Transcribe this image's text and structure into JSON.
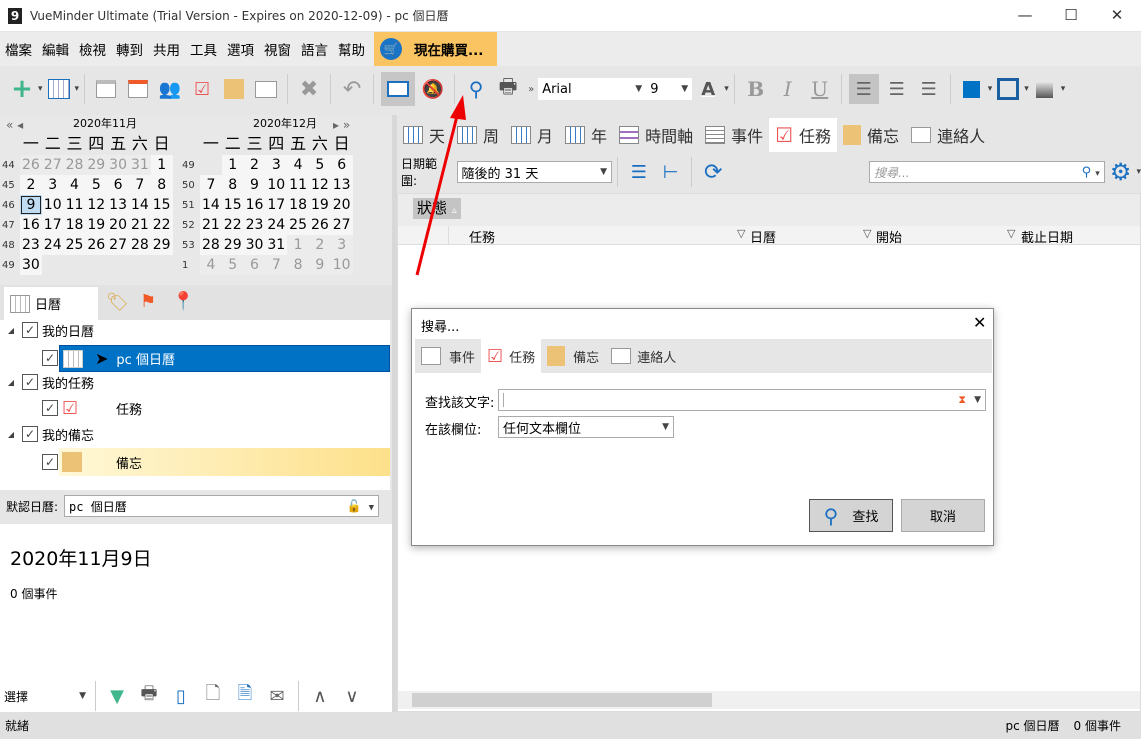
{
  "window": {
    "title": "VueMinder Ultimate (Trial Version - Expires on 2020-12-09) - pc 個日曆",
    "app_icon": "9",
    "minimize": "—",
    "maximize": "☐",
    "close": "✕"
  },
  "menu": [
    "檔案",
    "編輯",
    "檢視",
    "轉到",
    "共用",
    "工具",
    "選項",
    "視窗",
    "語言",
    "幫助"
  ],
  "buy_label": "現在購買...",
  "toolbar": {
    "font": "Arial",
    "size": "9",
    "bold": "B",
    "italic": "I",
    "underline": "U",
    "font_color": "A",
    "fill_color": "#0072c6",
    "border_color": "#1a5fa0"
  },
  "calendar": {
    "prev": "«  ◂",
    "next": "▸  »",
    "dow": [
      "一",
      "二",
      "三",
      "四",
      "五",
      "六",
      "日"
    ],
    "months": [
      {
        "title": "2020年11月",
        "selected": "9",
        "weeks": [
          [
            "44",
            "26",
            "27",
            "28",
            "29",
            "30",
            "31",
            "1"
          ],
          [
            "45",
            "2",
            "3",
            "4",
            "5",
            "6",
            "7",
            "8"
          ],
          [
            "46",
            "9",
            "10",
            "11",
            "12",
            "13",
            "14",
            "15"
          ],
          [
            "47",
            "16",
            "17",
            "18",
            "19",
            "20",
            "21",
            "22"
          ],
          [
            "48",
            "23",
            "24",
            "25",
            "26",
            "27",
            "28",
            "29"
          ],
          [
            "49",
            "30"
          ]
        ]
      },
      {
        "title": "2020年12月",
        "weeks": [
          [
            "49",
            "",
            "1",
            "2",
            "3",
            "4",
            "5",
            "6"
          ],
          [
            "50",
            "7",
            "8",
            "9",
            "10",
            "11",
            "12",
            "13"
          ],
          [
            "51",
            "14",
            "15",
            "16",
            "17",
            "18",
            "19",
            "20"
          ],
          [
            "52",
            "21",
            "22",
            "23",
            "24",
            "25",
            "26",
            "27"
          ],
          [
            "53",
            "28",
            "29",
            "30",
            "31",
            "1",
            "2",
            "3"
          ],
          [
            "1",
            "4",
            "5",
            "6",
            "7",
            "8",
            "9",
            "10"
          ]
        ]
      }
    ]
  },
  "left_tabs": {
    "calendar": "日曆"
  },
  "tree": {
    "my_calendars": "我的日曆",
    "pc_calendar": "pc 個日曆",
    "my_tasks": "我的任務",
    "tasks": "任務",
    "my_notes": "我的備忘",
    "notes": "備忘"
  },
  "default_calendar": {
    "label": "默認日曆:",
    "value": "pc 個日曆"
  },
  "detail": {
    "date": "2020年11月9日",
    "count": "0 個事件"
  },
  "left_bottom": {
    "select": "選擇"
  },
  "status": {
    "left": "就緒",
    "calendar": "pc 個日曆",
    "events": "0 個事件"
  },
  "views": [
    "天",
    "周",
    "月",
    "年",
    "時間軸",
    "事件",
    "任務",
    "備忘",
    "連絡人"
  ],
  "filter": {
    "range_label": "日期範圍:",
    "range_value": "隨後的 31 天",
    "search_placeholder": "搜尋..."
  },
  "grid": {
    "group": "狀態",
    "group_sort": "▵",
    "columns": [
      "任務",
      "日曆",
      "開始",
      "截止日期"
    ]
  },
  "dialog": {
    "title": "搜尋...",
    "tabs": [
      "事件",
      "任務",
      "備忘",
      "連絡人"
    ],
    "find_label": "查找該文字:",
    "find_value": "",
    "field_label": "在該欄位:",
    "field_value": "任何文本欄位",
    "find_button": "查找",
    "cancel_button": "取消"
  }
}
